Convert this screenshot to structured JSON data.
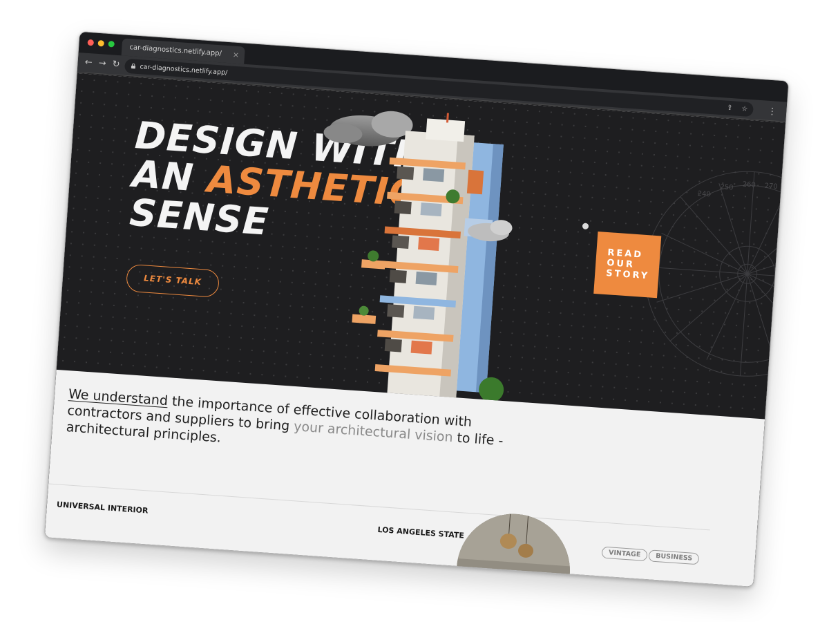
{
  "browser": {
    "tab_title": "car-diagnostics.netlify.app/",
    "tab_close": "×",
    "url": "car-diagnostics.netlify.app/",
    "nav": {
      "back": "←",
      "forward": "→",
      "reload": "↻"
    },
    "actions": {
      "share": "⇪",
      "bookmark": "☆",
      "menu": "⋮"
    }
  },
  "hero": {
    "headline_line1": "DESIGN WITH",
    "headline_line2_a": "AN ",
    "headline_line2_accent": "ASTHETIC",
    "headline_line3": "SENSE",
    "cta_label": "LET'S TALK",
    "story_line1": "READ",
    "story_line2": "OUR",
    "story_line3": "STORY",
    "dial_numbers": [
      "240",
      "250",
      "260",
      "270"
    ]
  },
  "intro": {
    "underlined": "We understand",
    "text_a": " the importance of effective collaboration with contractors and suppliers to bring ",
    "muted": "your architectural vision",
    "text_b": " to life - architectural principles."
  },
  "projects": {
    "left_label": "UNIVERSAL INTERIOR",
    "mid_label": "LOS ANGELES STATE",
    "tags": [
      "VINTAGE",
      "BUSINESS"
    ]
  },
  "colors": {
    "accent": "#ee8a3f",
    "hero_bg": "#1e1e20",
    "page_bg": "#f2f2f2",
    "chrome": "#343538"
  }
}
